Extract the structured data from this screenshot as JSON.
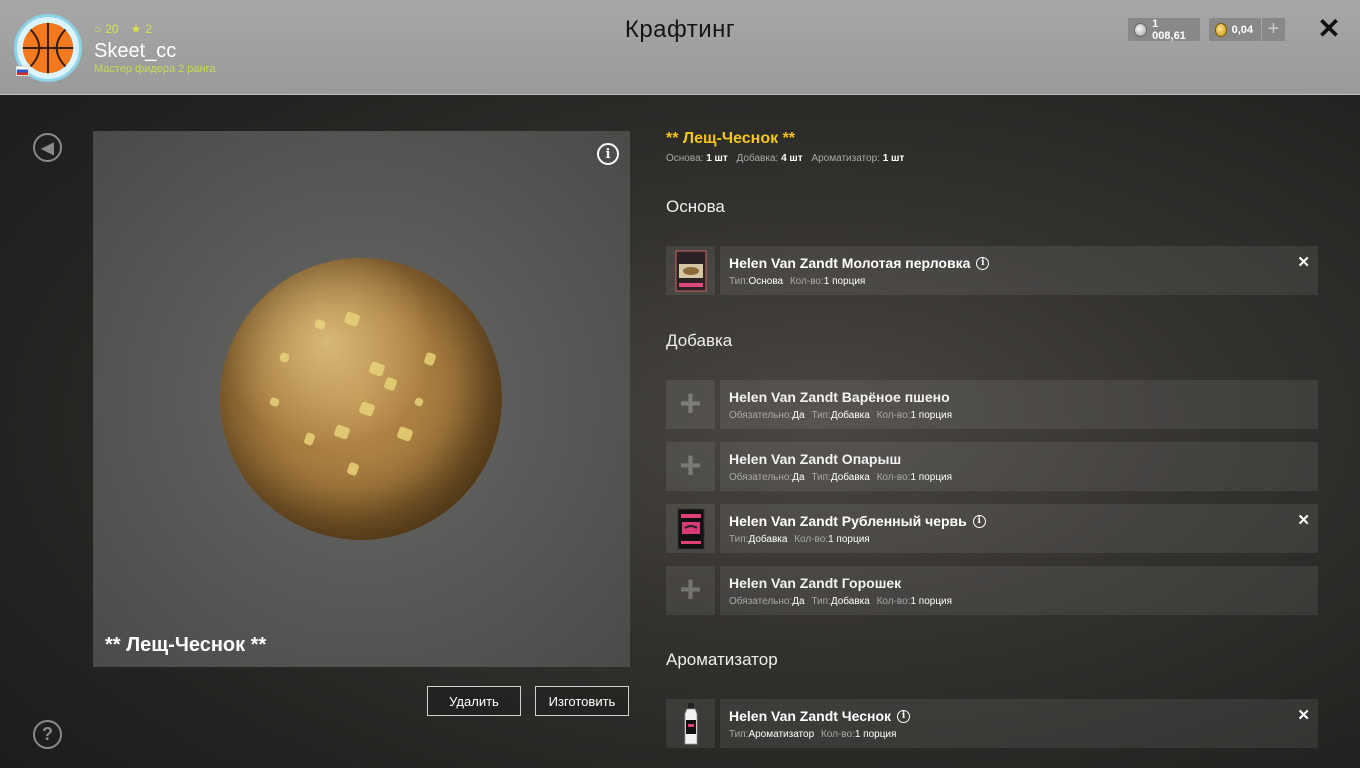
{
  "header": {
    "title": "Крафтинг",
    "username": "Skeet_cc",
    "rank": "Мастер фидера 2 ранга",
    "level": "20",
    "stars": "2",
    "silver_balance": "1 008,61",
    "gold_balance": "0,04",
    "add_label": "+",
    "close_label": "✕"
  },
  "preview": {
    "name": "** Лещ-Чеснок **",
    "info_label": "i"
  },
  "actions": {
    "delete_label": "Удалить",
    "craft_label": "Изготовить"
  },
  "recipe": {
    "title": "** Лещ-Чеснок **",
    "summary": [
      {
        "label": "Основа:",
        "value": "1 шт"
      },
      {
        "label": "Добавка:",
        "value": "4 шт"
      },
      {
        "label": "Ароматизатор:",
        "value": "1 шт"
      }
    ]
  },
  "sections": {
    "base_title": "Основа",
    "additive_title": "Добавка",
    "flavor_title": "Ароматизатор"
  },
  "base_items": [
    {
      "name": "Helen Van Zandt Молотая перловка",
      "meta": [
        [
          "Тип:",
          "Основа"
        ],
        [
          "Кол-во:",
          "1 порция"
        ]
      ]
    }
  ],
  "additive_items": [
    {
      "name": "Helen Van Zandt Варёное пшено",
      "meta": [
        [
          "Обязательно:",
          "Да"
        ],
        [
          "Тип:",
          "Добавка"
        ],
        [
          "Кол-во:",
          "1 порция"
        ]
      ]
    },
    {
      "name": "Helen Van Zandt Опарыш",
      "meta": [
        [
          "Обязательно:",
          "Да"
        ],
        [
          "Тип:",
          "Добавка"
        ],
        [
          "Кол-во:",
          "1 порция"
        ]
      ]
    },
    {
      "name": "Helen Van Zandt Рубленный червь",
      "meta": [
        [
          "Тип:",
          "Добавка"
        ],
        [
          "Кол-во:",
          "1 порция"
        ]
      ]
    },
    {
      "name": "Helen Van Zandt Горошек",
      "meta": [
        [
          "Обязательно:",
          "Да"
        ],
        [
          "Тип:",
          "Добавка"
        ],
        [
          "Кол-во:",
          "1 порция"
        ]
      ]
    }
  ],
  "flavor_items": [
    {
      "name": "Helen Van Zandt Чеснок",
      "meta": [
        [
          "Тип:",
          "Ароматизатор"
        ],
        [
          "Кол-во:",
          "1 порция"
        ]
      ]
    }
  ],
  "colors": {
    "accent": "#f6c51a",
    "rank": "#c6db52"
  }
}
